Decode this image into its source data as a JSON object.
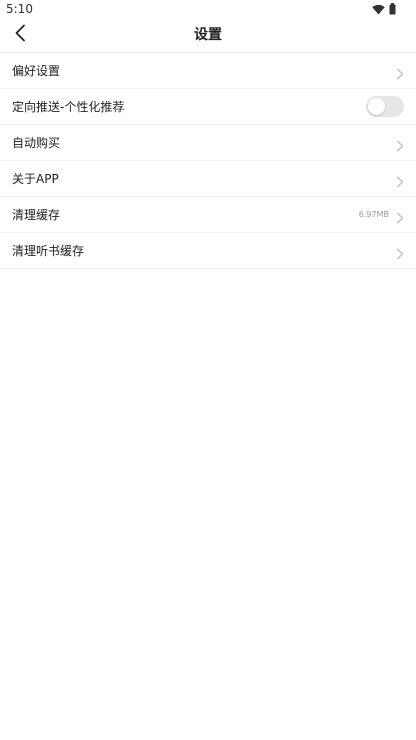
{
  "status_bar": {
    "time": "5:10",
    "icons": [
      "wifi-icon",
      "battery-icon"
    ]
  },
  "header": {
    "title": "设置",
    "back_icon": "chevron-left-icon"
  },
  "settings": {
    "items": [
      {
        "label": "偏好设置",
        "accessory": "chevron"
      },
      {
        "label": "定向推送-个性化推荐",
        "accessory": "toggle",
        "enabled": false
      },
      {
        "label": "自动购买",
        "accessory": "chevron"
      },
      {
        "label": "关于APP",
        "accessory": "chevron"
      },
      {
        "label": "清理缓存",
        "accessory": "chevron",
        "value": "6.97MB"
      },
      {
        "label": "清理听书缓存",
        "accessory": "chevron"
      }
    ]
  },
  "colors": {
    "background": "#ffffff",
    "text": "#222222",
    "secondary_text": "#9a9a9a",
    "divider": "#f2f2f2",
    "toggle_off": "#e6e6e6"
  }
}
